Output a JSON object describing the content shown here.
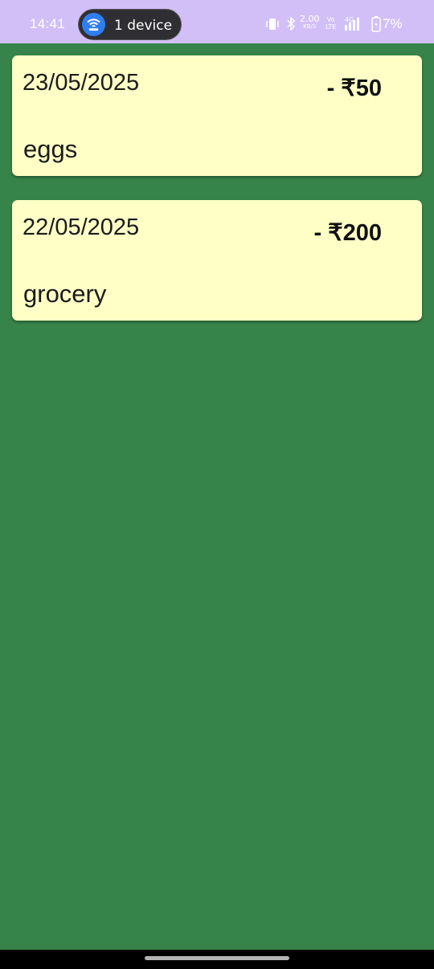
{
  "status_bar": {
    "time": "14:41",
    "device_pill_label": "1 device",
    "network_speed": "2.00",
    "network_speed_unit": "KB/S",
    "volte_top": "Vo",
    "volte_bottom": "LTE",
    "network_type": "4G",
    "battery": "7%",
    "background_color": "#d2bff7"
  },
  "app": {
    "background_color": "#37844a",
    "card_color": "#ffffc6"
  },
  "transactions": [
    {
      "date": "23/05/2025",
      "amount": "- ₹50",
      "description": "eggs"
    },
    {
      "date": "22/05/2025",
      "amount": "- ₹200",
      "description": "grocery"
    }
  ]
}
